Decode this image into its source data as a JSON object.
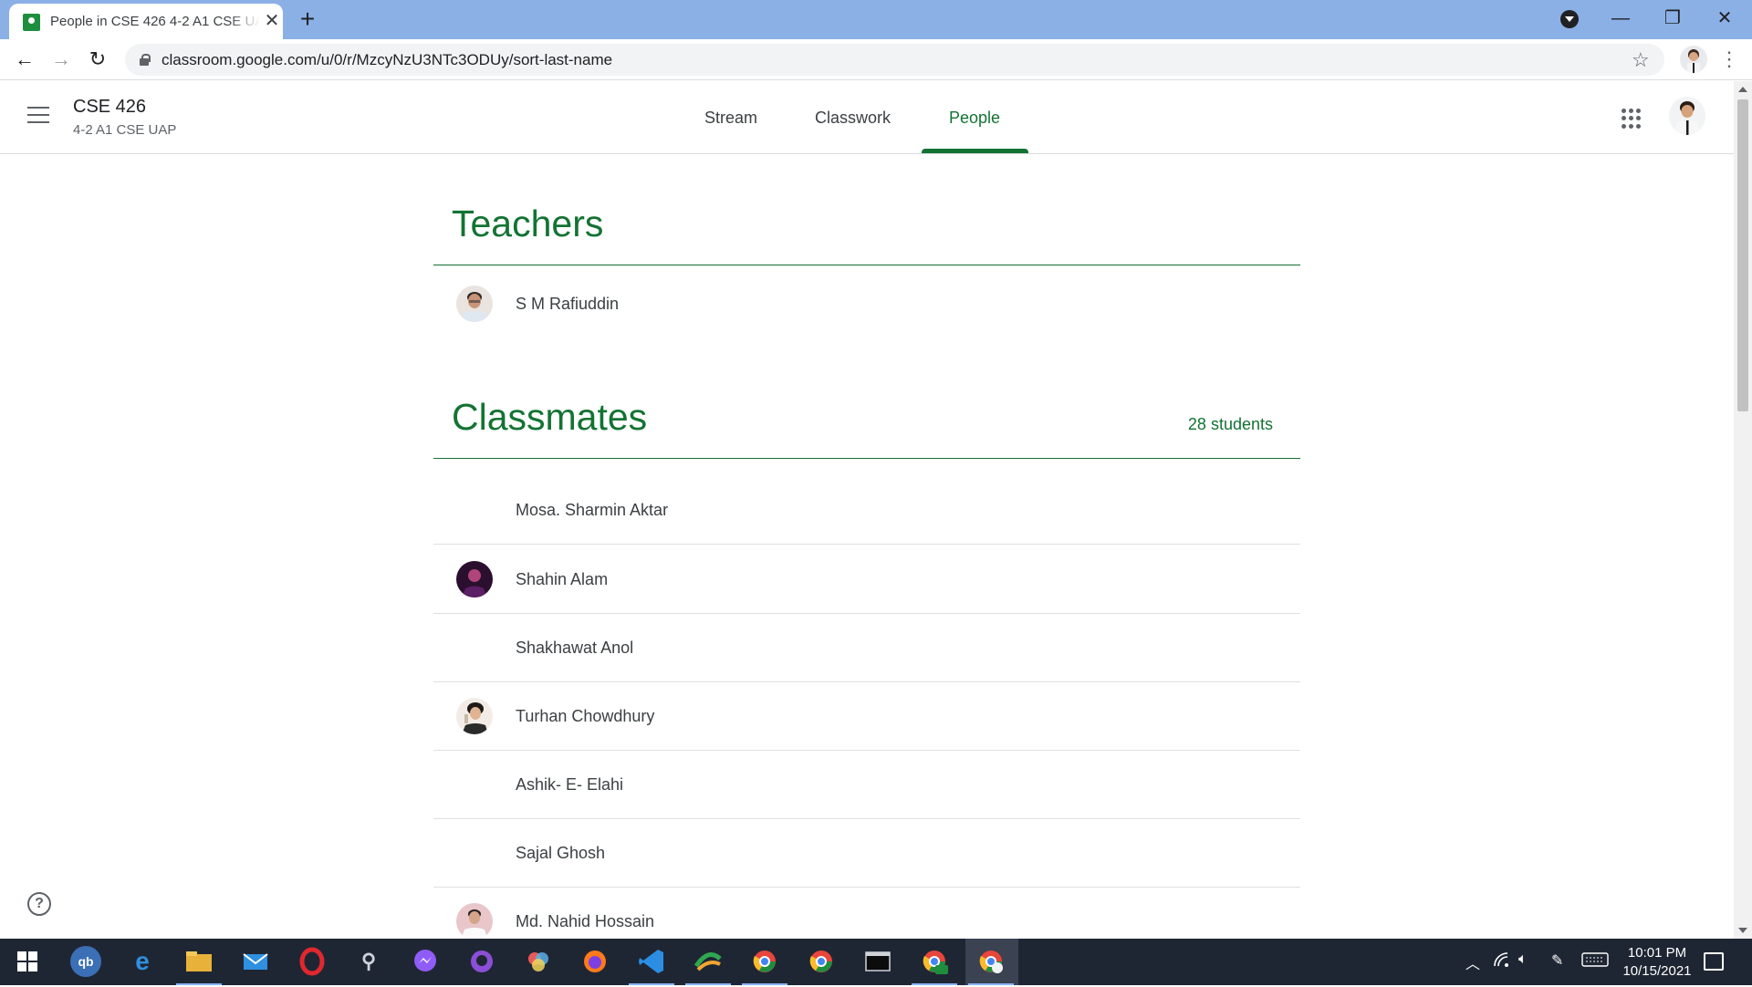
{
  "browser": {
    "tab_title": "People in CSE 426 4-2 A1 CSE UAP",
    "new_tab": "+",
    "close_tab": "✕",
    "minimize": "—",
    "restore": "❐",
    "close": "✕",
    "url": "classroom.google.com/u/0/r/MzcyNzU3NTc3ODUy/sort-last-name",
    "back": "←",
    "forward": "→",
    "reload": "↻",
    "star": "☆",
    "menu": "⋮"
  },
  "header": {
    "class_name": "CSE 426",
    "class_section": "4-2 A1 CSE UAP",
    "tabs": [
      {
        "label": "Stream",
        "active": false
      },
      {
        "label": "Classwork",
        "active": false
      },
      {
        "label": "People",
        "active": true
      }
    ]
  },
  "teachers": {
    "title": "Teachers",
    "people": [
      {
        "name": "S M Rafiuddin",
        "has_photo": true
      }
    ]
  },
  "classmates": {
    "title": "Classmates",
    "count": "28 students",
    "people": [
      {
        "name": "Mosa. Sharmin Aktar",
        "has_photo": false
      },
      {
        "name": "Shahin Alam",
        "has_photo": true
      },
      {
        "name": "Shakhawat Anol",
        "has_photo": false
      },
      {
        "name": "Turhan Chowdhury",
        "has_photo": true
      },
      {
        "name": "Ashik- E- Elahi",
        "has_photo": false
      },
      {
        "name": "Sajal Ghosh",
        "has_photo": false
      },
      {
        "name": "Md. Nahid Hossain",
        "has_photo": true
      }
    ]
  },
  "help": "?",
  "taskbar": {
    "apps": [
      "start-button",
      "qbittorrent-icon",
      "edge-icon",
      "file-explorer-icon",
      "mail-icon",
      "opera-icon",
      "satellite-app-icon",
      "messenger-icon",
      "github-desktop-icon",
      "paint-app-icon",
      "firefox-icon",
      "vscode-icon",
      "xampp-icon",
      "chrome-profile-icon",
      "chrome-icon",
      "terminal-icon",
      "chrome-ek-icon",
      "chrome-active-icon"
    ],
    "clock_time": "10:01 PM",
    "clock_date": "10/15/2021"
  },
  "colors": {
    "classroom_green": "#137333",
    "chrome_tabstrip": "#8bb0e6",
    "taskbar": "#1f2633"
  }
}
